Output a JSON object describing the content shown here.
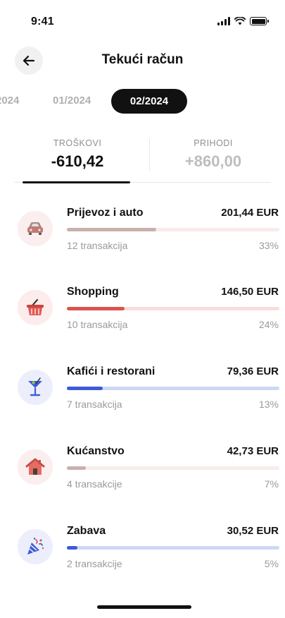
{
  "status_bar": {
    "time": "9:41"
  },
  "header": {
    "title": "Tekući račun"
  },
  "months": [
    {
      "label": "2024",
      "state": "partial"
    },
    {
      "label": "01/2024",
      "state": "inactive"
    },
    {
      "label": "02/2024",
      "state": "active"
    }
  ],
  "tabs": {
    "expenses": {
      "label": "TROŠKOVI",
      "amount": "-610,42"
    },
    "income": {
      "label": "PRIHODI",
      "amount": "+860,00"
    }
  },
  "categories": [
    {
      "name": "Prijevoz i auto",
      "amount": "201,44 EUR",
      "count": "12 transakcija",
      "percent_label": "33%",
      "percent": 0.42,
      "icon": "car-icon",
      "icon_bg": "#fbeeee",
      "bar_color": "#c9b0ac",
      "track_color": "#f7ecea"
    },
    {
      "name": "Shopping",
      "amount": "146,50 EUR",
      "count": "10 transakcija",
      "percent_label": "24%",
      "percent": 0.27,
      "icon": "shopping-basket-icon",
      "icon_bg": "#fdecec",
      "bar_color": "#d9534f",
      "track_color": "#fbdcdc"
    },
    {
      "name": "Kafići i restorani",
      "amount": "79,36 EUR",
      "count": "7 transakcija",
      "percent_label": "13%",
      "percent": 0.17,
      "icon": "cocktail-glass-icon",
      "icon_bg": "#eceffb",
      "bar_color": "#3d5bd9",
      "track_color": "#cfd7f5"
    },
    {
      "name": "Kućanstvo",
      "amount": "42,73 EUR",
      "count": "4 transakcije",
      "percent_label": "7%",
      "percent": 0.09,
      "icon": "house-icon",
      "icon_bg": "#fbeeee",
      "bar_color": "#c9b0ac",
      "track_color": "#f7ecea"
    },
    {
      "name": "Zabava",
      "amount": "30,52 EUR",
      "count": "2 transakcije",
      "percent_label": "5%",
      "percent": 0.05,
      "icon": "party-popper-icon",
      "icon_bg": "#eceffb",
      "bar_color": "#3d5bd9",
      "track_color": "#cfd7f5"
    }
  ]
}
